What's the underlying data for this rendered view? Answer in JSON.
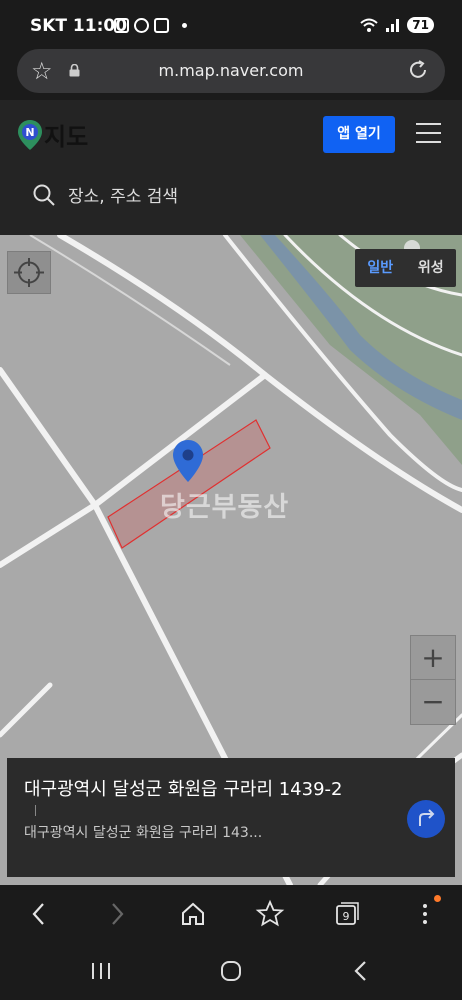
{
  "status_bar": {
    "time": "SKT 11:00",
    "battery": "71"
  },
  "browser": {
    "url": "m.map.naver.com"
  },
  "header": {
    "logo_text": "지도",
    "open_app_label": "앱 열기",
    "search_placeholder": "장소, 주소 검색"
  },
  "map": {
    "layer_options": [
      "일반",
      "위성"
    ],
    "selected_layer": "일반",
    "zoom_in_label": "+",
    "zoom_out_label": "−",
    "watermark": "당근부동산"
  },
  "place_card": {
    "address": "대구광역시 달성군 화원읍 구라리 1439-2",
    "sub_address": "대구광역시 달성군 화원읍 구라리 143..."
  },
  "toolbar": {
    "tabs_count": "9"
  },
  "colors": {
    "accent": "#1062f3",
    "map_land": "#a9a9a9",
    "parcel_outline": "#e03030"
  }
}
